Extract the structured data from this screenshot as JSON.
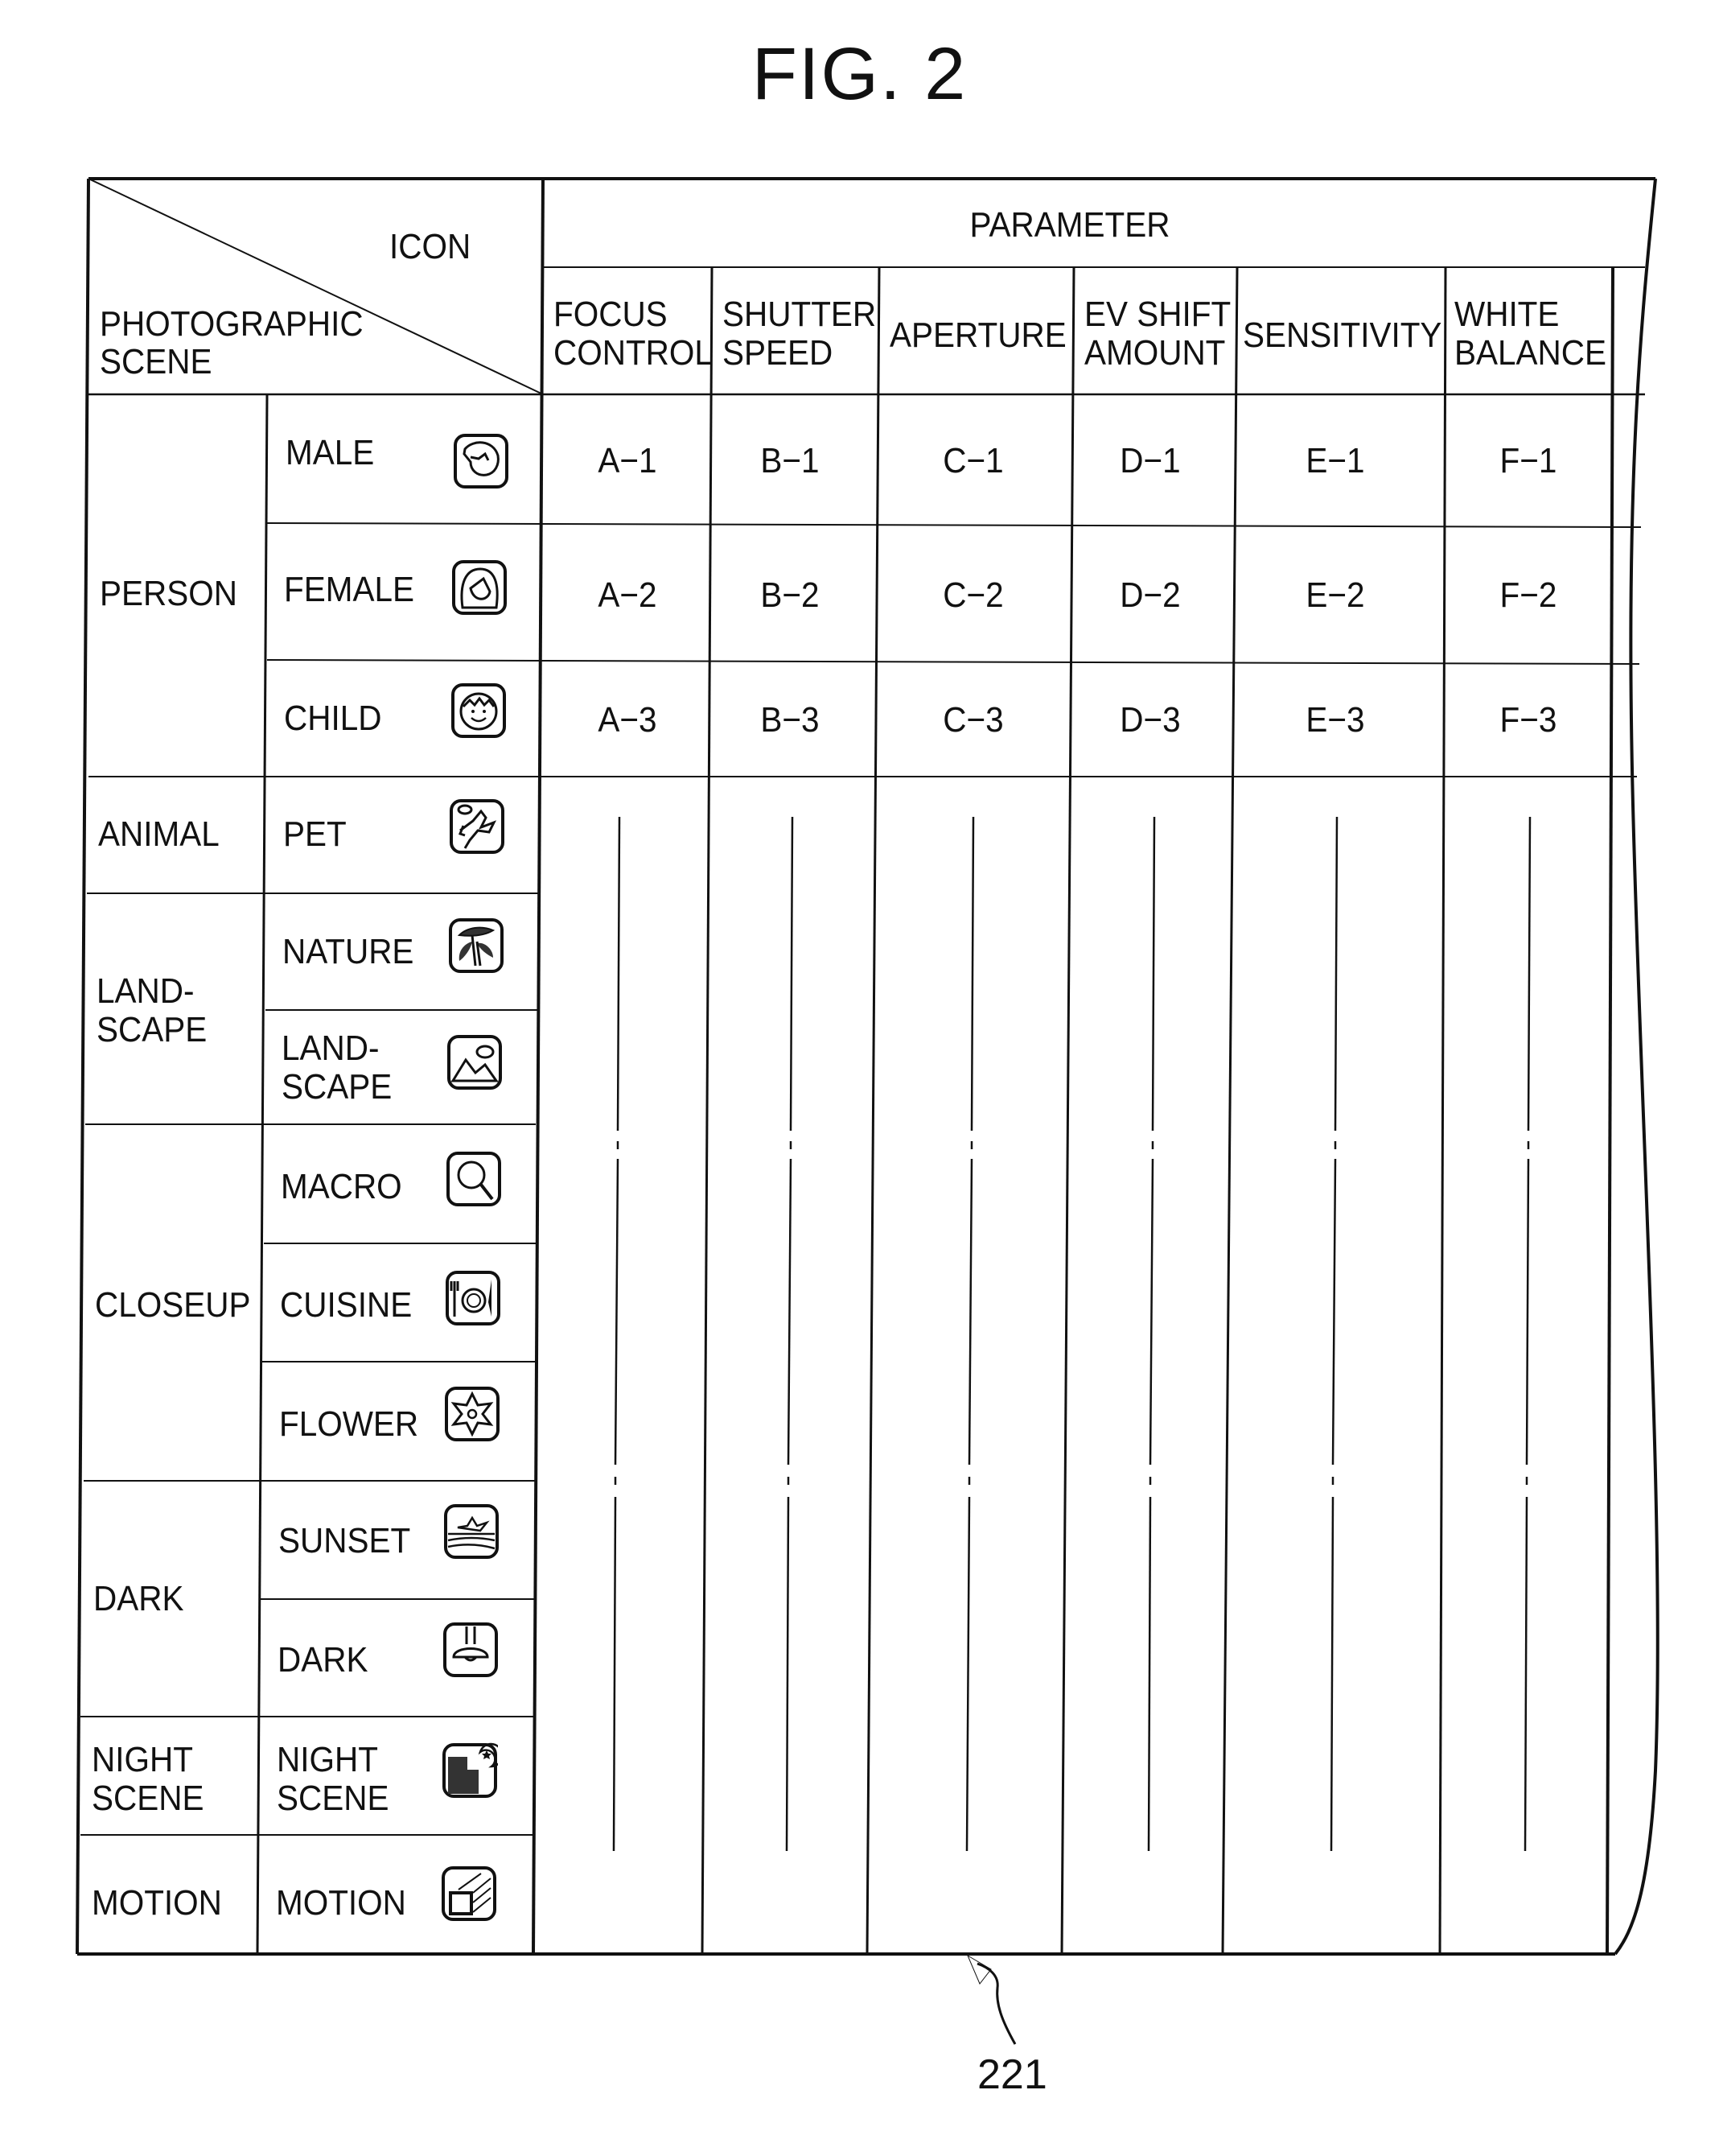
{
  "figure": {
    "title": "FIG. 2",
    "reference_numeral": "221"
  },
  "table": {
    "corner": {
      "top_right_label": "ICON",
      "bottom_left_label": [
        "PHOTOGRAPHIC",
        "SCENE"
      ]
    },
    "parameter_header": "PARAMETER",
    "parameter_columns": [
      {
        "key": "focus",
        "label": [
          "FOCUS",
          "CONTROL"
        ]
      },
      {
        "key": "shutter",
        "label": [
          "SHUTTER",
          "SPEED"
        ]
      },
      {
        "key": "aperture",
        "label": [
          "APERTURE"
        ]
      },
      {
        "key": "ev",
        "label": [
          "EV SHIFT",
          "AMOUNT"
        ]
      },
      {
        "key": "sensitivity",
        "label": [
          "SENSITIVITY"
        ]
      },
      {
        "key": "wb",
        "label": [
          "WHITE",
          "BALANCE"
        ]
      }
    ],
    "groups": [
      {
        "label": [
          "PERSON"
        ],
        "scenes": [
          {
            "label": [
              "MALE"
            ],
            "icon": "male-face-icon",
            "values": [
              "A-1",
              "B-1",
              "C-1",
              "D-1",
              "E-1",
              "F-1"
            ]
          },
          {
            "label": [
              "FEMALE"
            ],
            "icon": "female-face-icon",
            "values": [
              "A-2",
              "B-2",
              "C-2",
              "D-2",
              "E-2",
              "F-2"
            ]
          },
          {
            "label": [
              "CHILD"
            ],
            "icon": "child-face-icon",
            "values": [
              "A-3",
              "B-3",
              "C-3",
              "D-3",
              "E-3",
              "F-3"
            ]
          }
        ]
      },
      {
        "label": [
          "ANIMAL"
        ],
        "scenes": [
          {
            "label": [
              "PET"
            ],
            "icon": "pet-dog-icon"
          }
        ]
      },
      {
        "label": [
          "LAND-",
          "SCAPE"
        ],
        "scenes": [
          {
            "label": [
              "NATURE"
            ],
            "icon": "palm-tree-icon"
          },
          {
            "label": [
              "LAND-",
              "SCAPE"
            ],
            "icon": "mountain-icon"
          }
        ]
      },
      {
        "label": [
          "CLOSEUP"
        ],
        "scenes": [
          {
            "label": [
              "MACRO"
            ],
            "icon": "magnifier-icon"
          },
          {
            "label": [
              "CUISINE"
            ],
            "icon": "plate-cutlery-icon"
          },
          {
            "label": [
              "FLOWER"
            ],
            "icon": "flower-icon"
          }
        ]
      },
      {
        "label": [
          "DARK"
        ],
        "scenes": [
          {
            "label": [
              "SUNSET"
            ],
            "icon": "sunset-icon"
          },
          {
            "label": [
              "DARK"
            ],
            "icon": "lamp-icon"
          }
        ]
      },
      {
        "label": [
          "NIGHT",
          "SCENE"
        ],
        "scenes": [
          {
            "label": [
              "NIGHT",
              "SCENE"
            ],
            "icon": "night-city-icon"
          }
        ]
      },
      {
        "label": [
          "MOTION"
        ],
        "scenes": [
          {
            "label": [
              "MOTION"
            ],
            "icon": "motion-icon"
          }
        ]
      }
    ],
    "continuation_note": "remaining parameter values omitted (dash-dot continuation lines)"
  }
}
